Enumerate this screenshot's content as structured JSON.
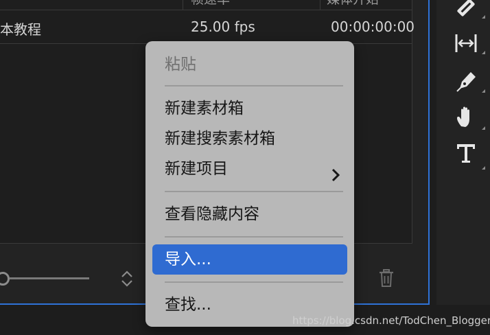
{
  "project": {
    "columns": [
      {
        "label": ""
      },
      {
        "label": "帧速率"
      },
      {
        "label": "媒体开始"
      }
    ],
    "rows": [
      {
        "name": "本教程",
        "frame_rate": "25.00 fps",
        "media_start": "00:00:00:00"
      }
    ]
  },
  "context_menu": {
    "items": [
      {
        "label": "粘贴",
        "state": "disabled"
      },
      {
        "label": "新建素材箱",
        "state": "normal"
      },
      {
        "label": "新建搜索素材箱",
        "state": "normal"
      },
      {
        "label": "新建项目",
        "state": "normal",
        "submenu": true
      },
      {
        "label": "查看隐藏内容",
        "state": "normal"
      },
      {
        "label": "导入...",
        "state": "selected"
      },
      {
        "label": "查找...",
        "state": "normal"
      }
    ]
  },
  "tools": [
    {
      "name": "razor-icon"
    },
    {
      "name": "slip-icon"
    },
    {
      "name": "pen-icon"
    },
    {
      "name": "hand-icon"
    },
    {
      "name": "type-icon"
    }
  ],
  "colors": {
    "accent": "#2f73d8",
    "menu_bg": "#b8b8b8",
    "menu_selected": "#2f6bd1",
    "panel_bg": "#232323"
  },
  "watermark": "https://blog.csdn.net/TodChen_Blogger"
}
